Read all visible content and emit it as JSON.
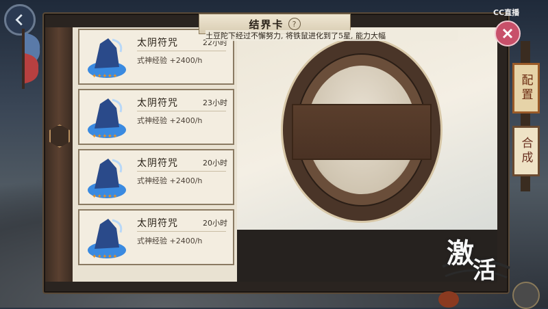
{
  "header": {
    "title": "结界卡",
    "help_label": "?"
  },
  "marquee": "土豆陀下经过不懈努力, 将铁鼠进化到了5星, 能力大幅",
  "watermark": "CC直播",
  "cards": [
    {
      "name": "太阴符咒",
      "time": "22小时",
      "bonus_label": "式神经验",
      "bonus_value": "+2400/h"
    },
    {
      "name": "太阴符咒",
      "time": "23小时",
      "bonus_label": "式神经验",
      "bonus_value": "+2400/h"
    },
    {
      "name": "太阴符咒",
      "time": "20小时",
      "bonus_label": "式神经验",
      "bonus_value": "+2400/h"
    },
    {
      "name": "太阴符咒",
      "time": "20小时",
      "bonus_label": "式神经验",
      "bonus_value": "+2400/h"
    }
  ],
  "side_tabs": [
    {
      "label": "配置",
      "active": true
    },
    {
      "label": "合成",
      "active": false
    }
  ],
  "stamp": {
    "char1": "激",
    "char2": "活"
  },
  "colors": {
    "accent_tab": "#9a5a28",
    "close": "#c8506a",
    "card_border": "#8a7a62"
  },
  "icons": [
    "back-arrow-icon",
    "close-icon",
    "help-icon",
    "talisman-card-icon"
  ]
}
